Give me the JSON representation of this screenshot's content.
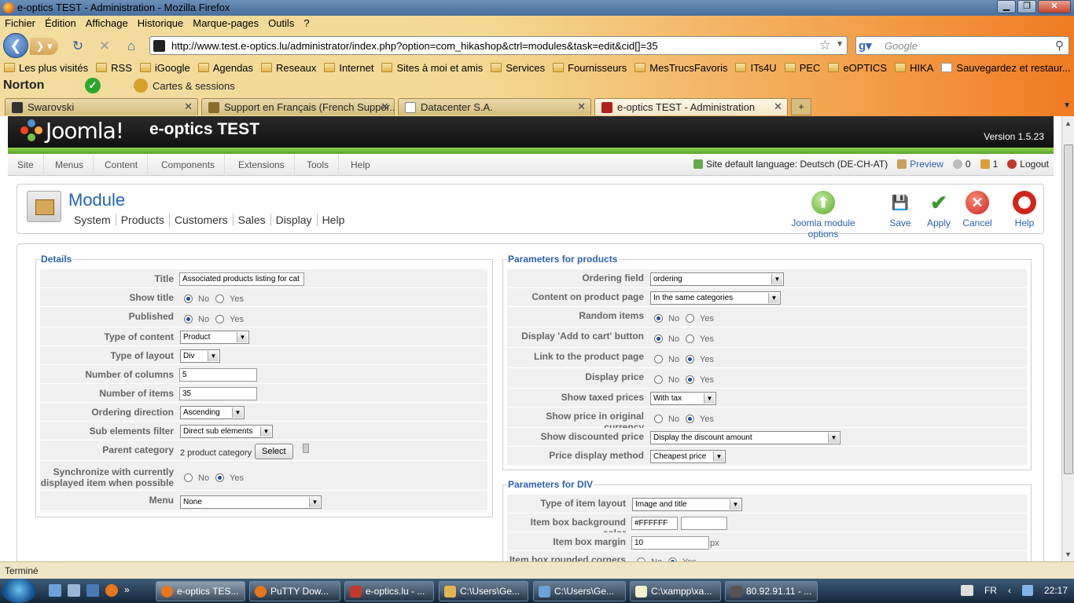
{
  "window": {
    "title": "e-optics TEST - Administration - Mozilla Firefox"
  },
  "menubar": [
    "Fichier",
    "Édition",
    "Affichage",
    "Historique",
    "Marque-pages",
    "Outils",
    "?"
  ],
  "navbar": {
    "url": "http://www.test.e-optics.lu/administrator/index.php?option=com_hikashop&ctrl=modules&task=edit&cid[]=35",
    "search_placeholder": "Google"
  },
  "bookmarks": [
    "Les plus visités",
    "RSS",
    "iGoogle",
    "Agendas",
    "Reseaux",
    "Internet",
    "Sites à moi et amis",
    "Services",
    "Fournisseurs",
    "MesTrucsFavoris",
    "ITs4U",
    "PEC",
    "eOPTICS",
    "HIKA",
    "Sauvegardez et restaur..."
  ],
  "norton": {
    "brand": "Norton",
    "cards": "Cartes & sessions"
  },
  "tabs": [
    {
      "label": "Swarovski"
    },
    {
      "label": "Support en Français (French Suppor..."
    },
    {
      "label": "Datacenter S.A."
    },
    {
      "label": "e-optics TEST - Administration"
    }
  ],
  "joomla": {
    "logo": "Joomla!",
    "site_name": "e-optics TEST",
    "version": "Version 1.5.23",
    "menu": [
      "Site",
      "Menus",
      "Content",
      "Components",
      "Extensions",
      "Tools",
      "Help"
    ],
    "status": {
      "language": "Site default language: Deutsch (DE-CH-AT)",
      "preview": "Preview",
      "messages": "0",
      "users": "1",
      "logout": "Logout"
    }
  },
  "module": {
    "title": "Module",
    "submenu": [
      "System",
      "Products",
      "Customers",
      "Sales",
      "Display",
      "Help"
    ],
    "buttons": {
      "options": "Joomla module options",
      "save": "Save",
      "apply": "Apply",
      "cancel": "Cancel",
      "help": "Help"
    }
  },
  "details": {
    "legend": "Details",
    "title_label": "Title",
    "title_value": "Associated products listing for cat",
    "show_title_label": "Show title",
    "published_label": "Published",
    "type_content_label": "Type of content",
    "type_content_value": "Product",
    "type_layout_label": "Type of layout",
    "type_layout_value": "Div",
    "columns_label": "Number of columns",
    "columns_value": "5",
    "items_label": "Number of items",
    "items_value": "35",
    "ordering_dir_label": "Ordering direction",
    "ordering_dir_value": "Ascending",
    "sub_filter_label": "Sub elements filter",
    "sub_filter_value": "Direct sub elements",
    "parent_label": "Parent category",
    "parent_value": "2 product category",
    "select_button": "Select",
    "sync_label_1": "Synchronize with currently",
    "sync_label_2": "displayed item when possible",
    "menu_label": "Menu",
    "menu_value": "None",
    "no": "No",
    "yes": "Yes"
  },
  "params_products": {
    "legend": "Parameters for products",
    "ordering_field_label": "Ordering field",
    "ordering_field_value": "ordering",
    "content_label": "Content on product page",
    "content_value": "In the same categories",
    "random_label": "Random items",
    "add_to_cart_label": "Display 'Add to cart' button",
    "link_label": "Link to the product page",
    "display_price_label": "Display price",
    "taxed_label": "Show taxed prices",
    "taxed_value": "With tax",
    "orig_currency_label": "Show price in original currency",
    "discounted_label": "Show discounted price",
    "discounted_value": "Display the discount amount",
    "price_method_label": "Price display method",
    "price_method_value": "Cheapest price"
  },
  "params_div": {
    "legend": "Parameters for DIV",
    "item_layout_label": "Type of item layout",
    "item_layout_value": "Image and title",
    "bg_color_label": "Item box background color",
    "bg_color_value": "#FFFFFF",
    "margin_label": "Item box margin",
    "margin_value": "10",
    "margin_unit": "px",
    "rounded_label": "Item box rounded corners"
  },
  "statusbar": "Terminé",
  "taskbar": {
    "items": [
      "e-optics TES...",
      "PuTTY Dow...",
      "e-optics.lu - ...",
      "C:\\Users\\Ge...",
      "C:\\Users\\Ge...",
      "C:\\xampp\\xa...",
      "80.92.91.11 - ..."
    ],
    "lang": "FR",
    "time": "22:17"
  }
}
